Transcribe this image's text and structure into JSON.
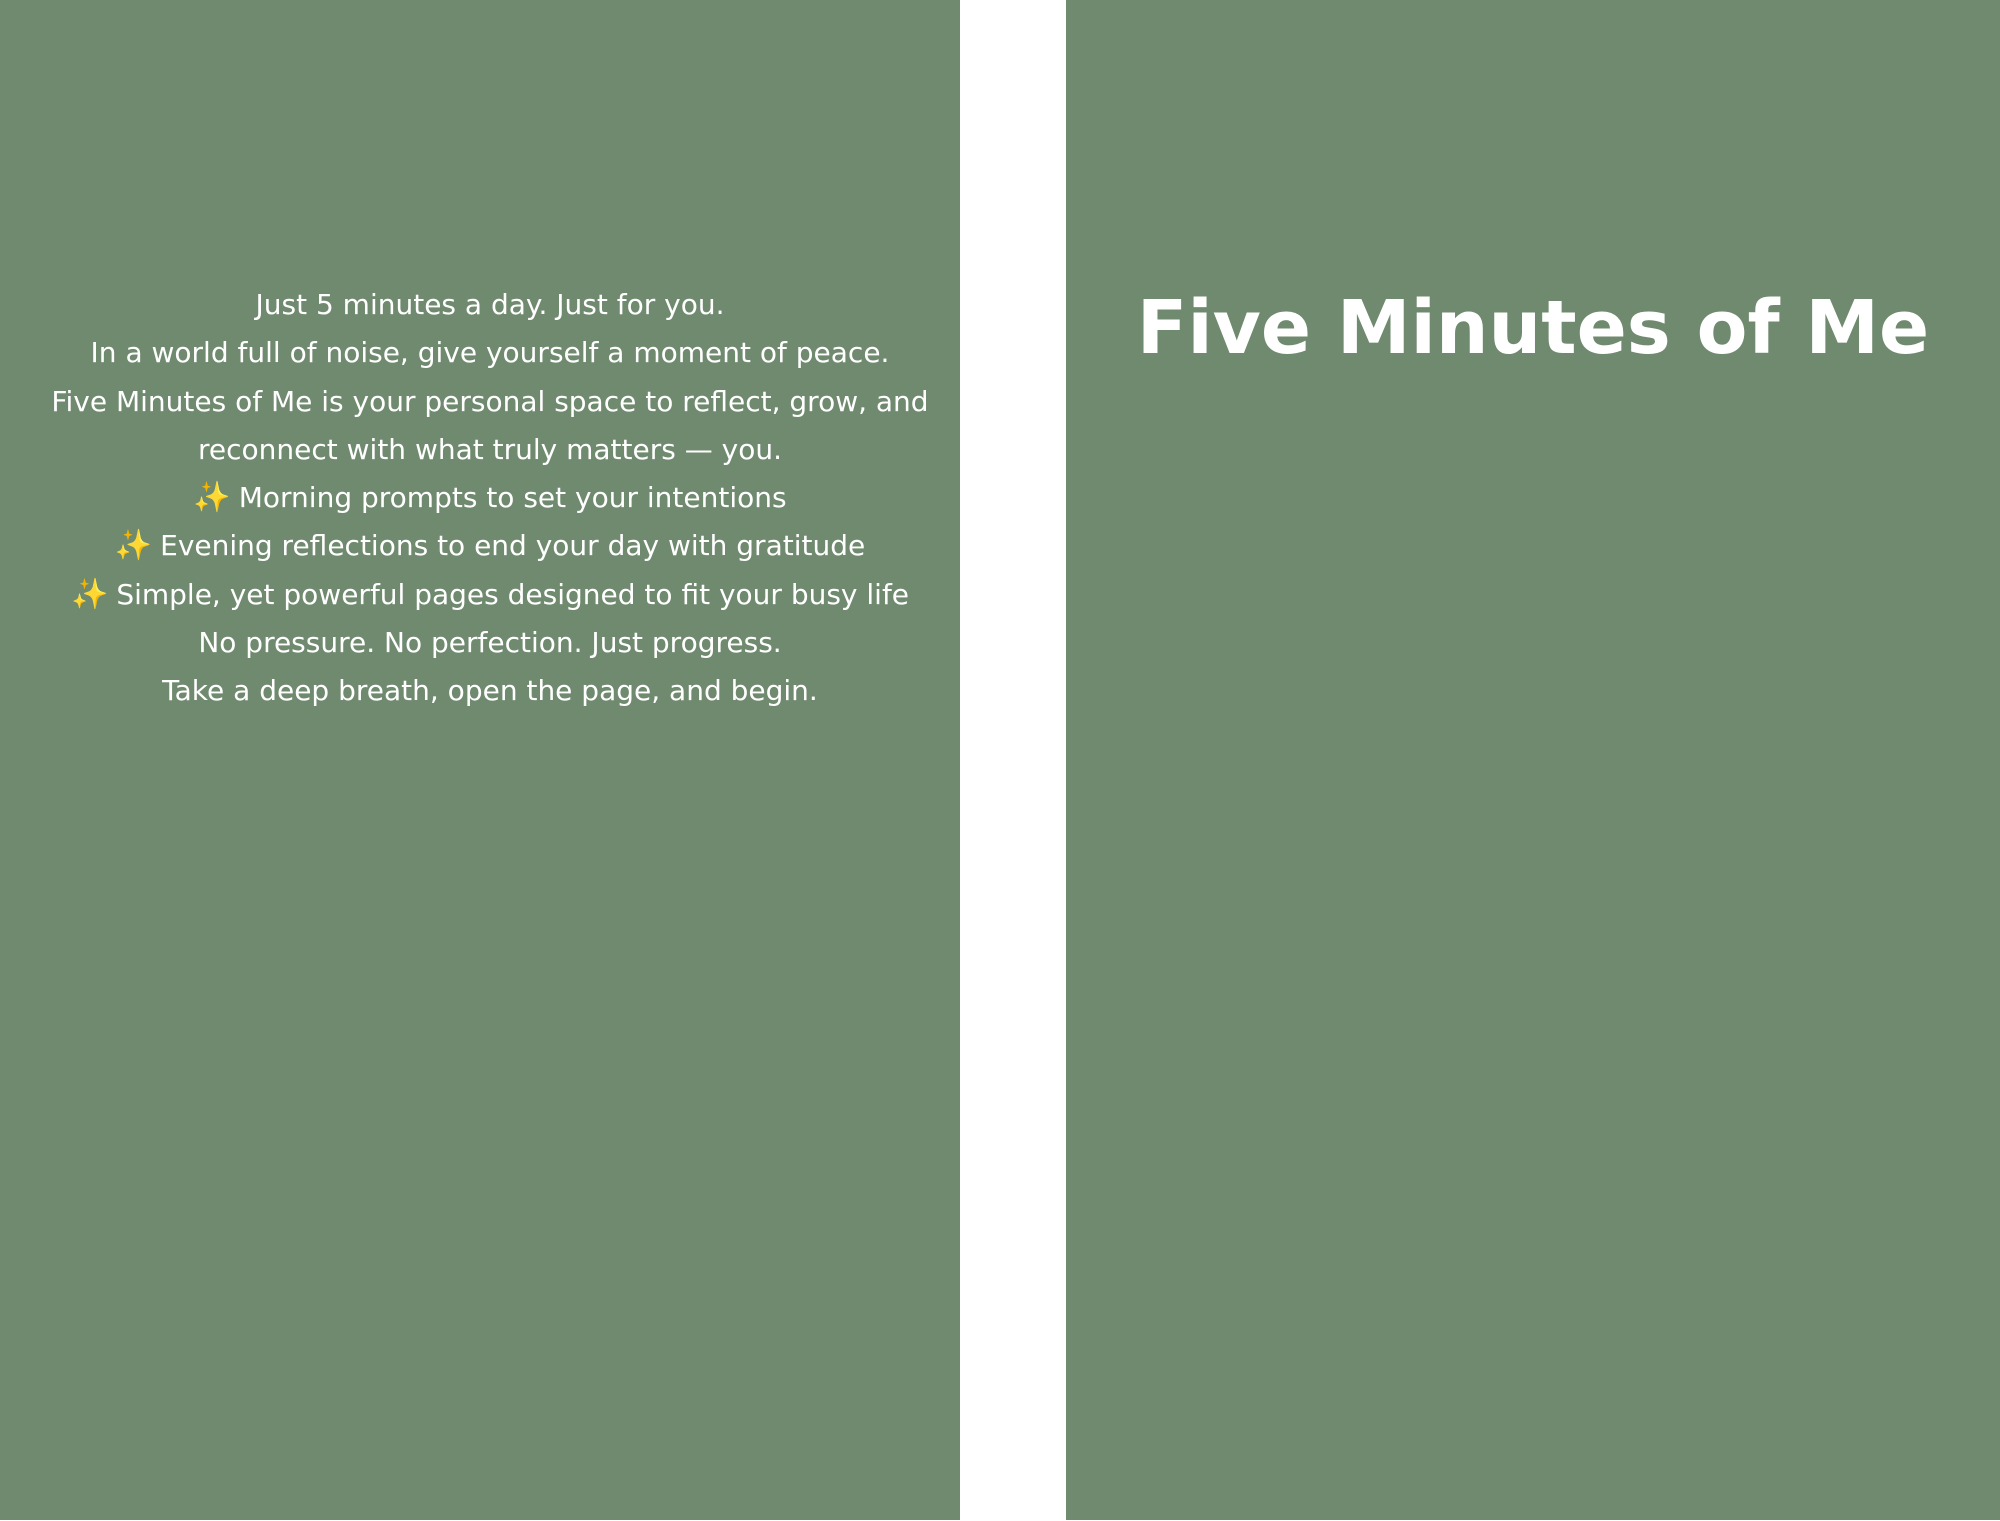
{
  "colors": {
    "cover_background": "#6f8a6e",
    "spine_background": "#ffffff",
    "text": "#ffffff",
    "sparkle": "#f2b13a"
  },
  "back_cover": {
    "lines": [
      "Just 5 minutes a day. Just for you.",
      "In a world full of noise, give yourself a moment of peace.",
      "Five Minutes of Me is your personal space to reflect, grow, and",
      "reconnect with what truly matters — you."
    ],
    "features": [
      {
        "icon": "sparkles-icon",
        "glyph": "✨",
        "text": "Morning prompts to set your intentions"
      },
      {
        "icon": "sparkles-icon",
        "glyph": "✨",
        "text": "Evening reflections to end your day with gratitude"
      },
      {
        "icon": "sparkles-icon",
        "glyph": "✨",
        "text": "Simple, yet powerful pages designed to fit your busy life"
      }
    ],
    "closing_lines": [
      "No pressure. No perfection. Just progress.",
      "Take a deep breath, open the page, and begin."
    ]
  },
  "front_cover": {
    "title": "Five Minutes of Me"
  }
}
